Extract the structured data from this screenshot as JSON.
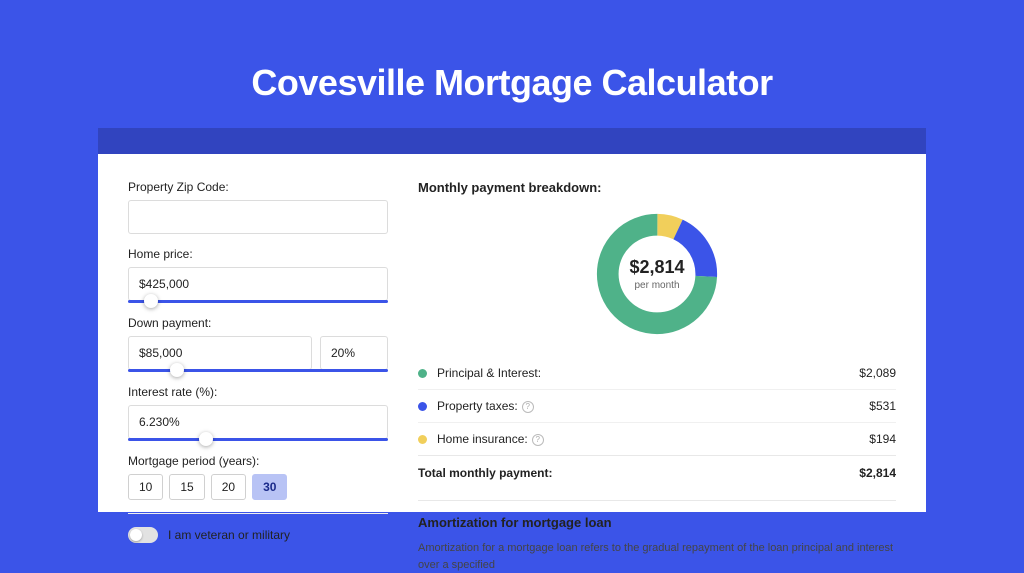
{
  "header": {
    "title": "Covesville Mortgage Calculator"
  },
  "form": {
    "zip": {
      "label": "Property Zip Code:",
      "value": ""
    },
    "price": {
      "label": "Home price:",
      "value": "$425,000",
      "slider_pct": 9
    },
    "down": {
      "label": "Down payment:",
      "value": "$85,000",
      "pct": "20%",
      "slider_pct": 19
    },
    "rate": {
      "label": "Interest rate (%):",
      "value": "6.230%",
      "slider_pct": 30
    },
    "period": {
      "label": "Mortgage period (years):",
      "options": [
        "10",
        "15",
        "20",
        "30"
      ],
      "active": "30"
    },
    "veteran": {
      "label": "I am veteran or military",
      "on": false
    }
  },
  "breakdown": {
    "title": "Monthly payment breakdown:",
    "center_amount": "$2,814",
    "center_sub": "per month",
    "items": [
      {
        "label": "Principal & Interest:",
        "value": "$2,089",
        "color": "#4fb289",
        "info": false
      },
      {
        "label": "Property taxes:",
        "value": "$531",
        "color": "#3b54e8",
        "info": true
      },
      {
        "label": "Home insurance:",
        "value": "$194",
        "color": "#f1cf5b",
        "info": true
      }
    ],
    "total": {
      "label": "Total monthly payment:",
      "value": "$2,814"
    }
  },
  "chart_data": {
    "type": "pie",
    "title": "Monthly payment breakdown",
    "series": [
      {
        "name": "Principal & Interest",
        "value": 2089,
        "color": "#4fb289"
      },
      {
        "name": "Property taxes",
        "value": 531,
        "color": "#3b54e8"
      },
      {
        "name": "Home insurance",
        "value": 194,
        "color": "#f1cf5b"
      }
    ],
    "total": 2814,
    "center_label": "$2,814 per month"
  },
  "amort": {
    "title": "Amortization for mortgage loan",
    "text": "Amortization for a mortgage loan refers to the gradual repayment of the loan principal and interest over a specified"
  }
}
